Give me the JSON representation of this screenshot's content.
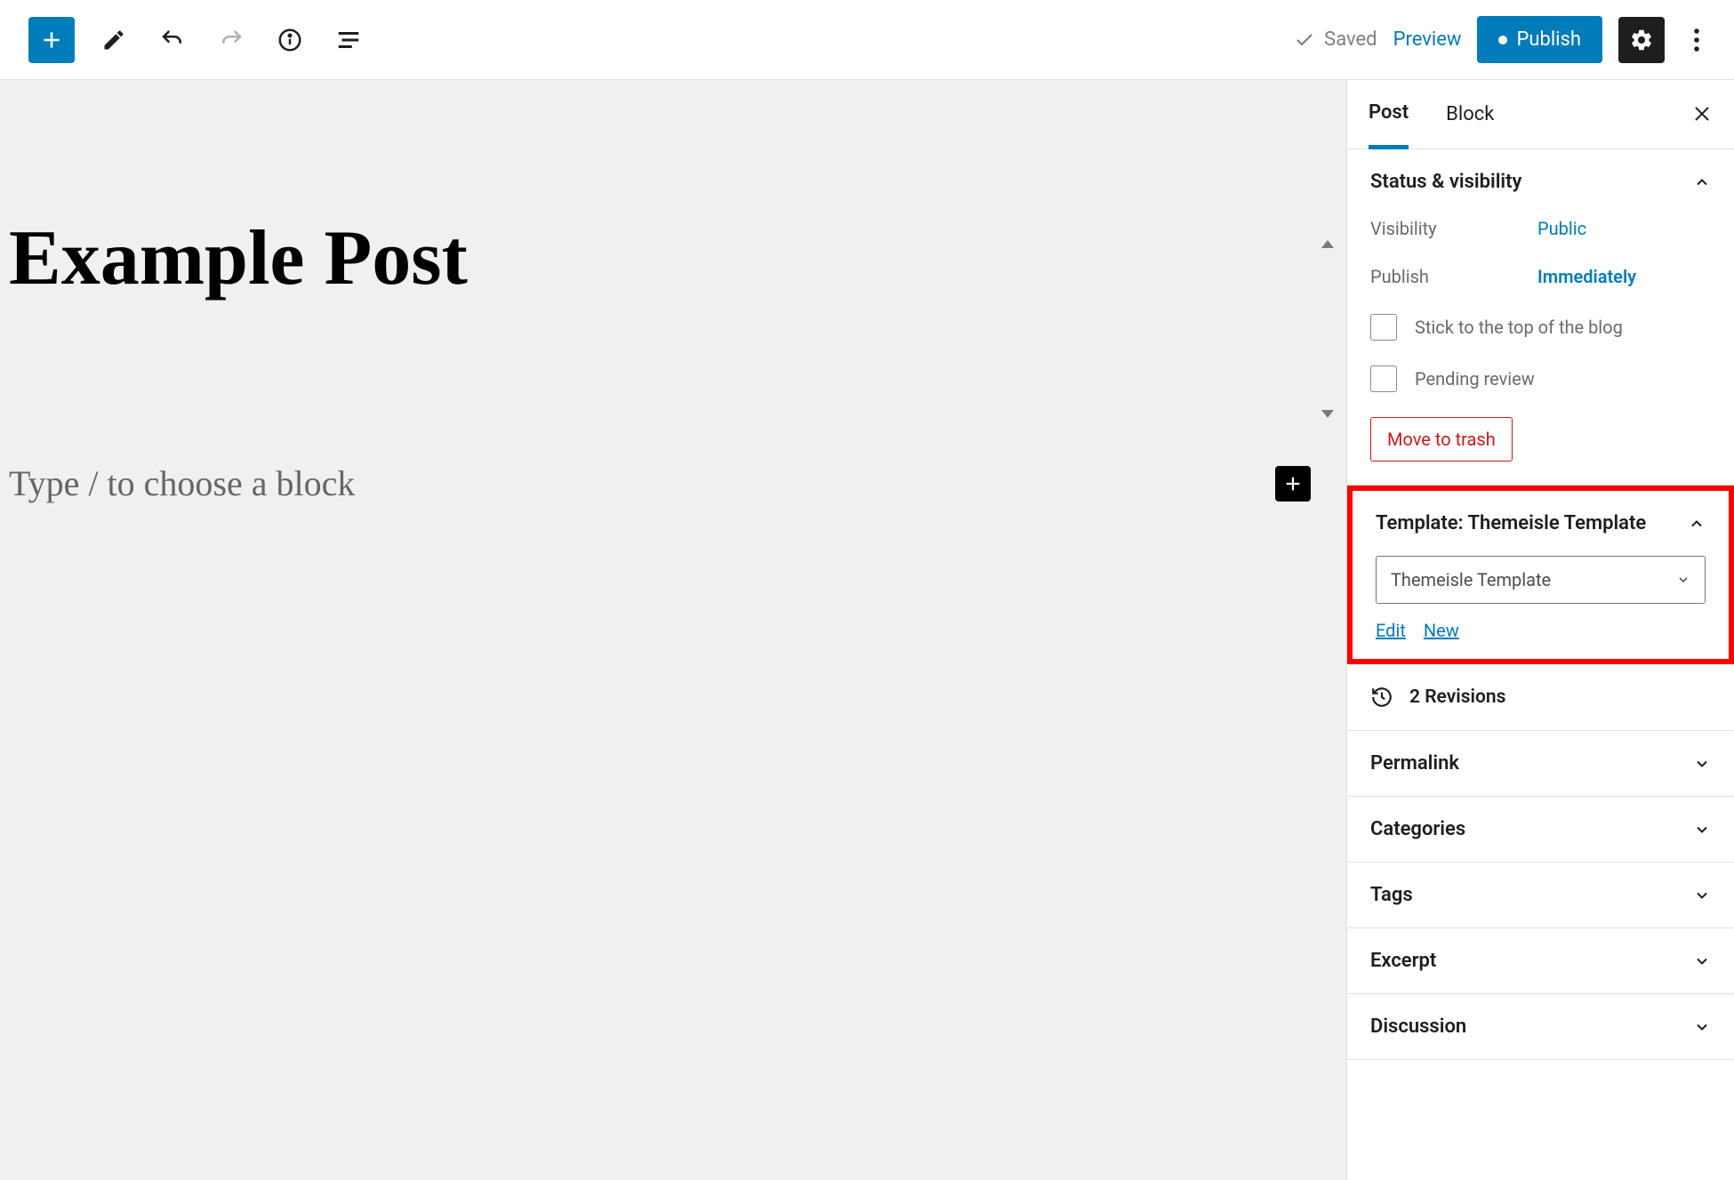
{
  "topbar": {
    "saved_label": "Saved",
    "preview_label": "Preview",
    "publish_label": "Publish"
  },
  "editor": {
    "title": "Example Post",
    "placeholder": "Type / to choose a block"
  },
  "sidebar": {
    "tabs": {
      "post": "Post",
      "block": "Block"
    },
    "status": {
      "heading": "Status & visibility",
      "visibility_label": "Visibility",
      "visibility_value": "Public",
      "publish_label": "Publish",
      "publish_value": "Immediately",
      "stick_label": "Stick to the top of the blog",
      "pending_label": "Pending review",
      "trash_label": "Move to trash"
    },
    "template": {
      "heading": "Template: Themeisle Template",
      "selected": "Themeisle Template",
      "edit": "Edit",
      "new": "New"
    },
    "revisions": {
      "label": "2 Revisions"
    },
    "permalink": {
      "heading": "Permalink"
    },
    "categories": {
      "heading": "Categories"
    },
    "tags": {
      "heading": "Tags"
    },
    "excerpt": {
      "heading": "Excerpt"
    },
    "discussion": {
      "heading": "Discussion"
    }
  }
}
